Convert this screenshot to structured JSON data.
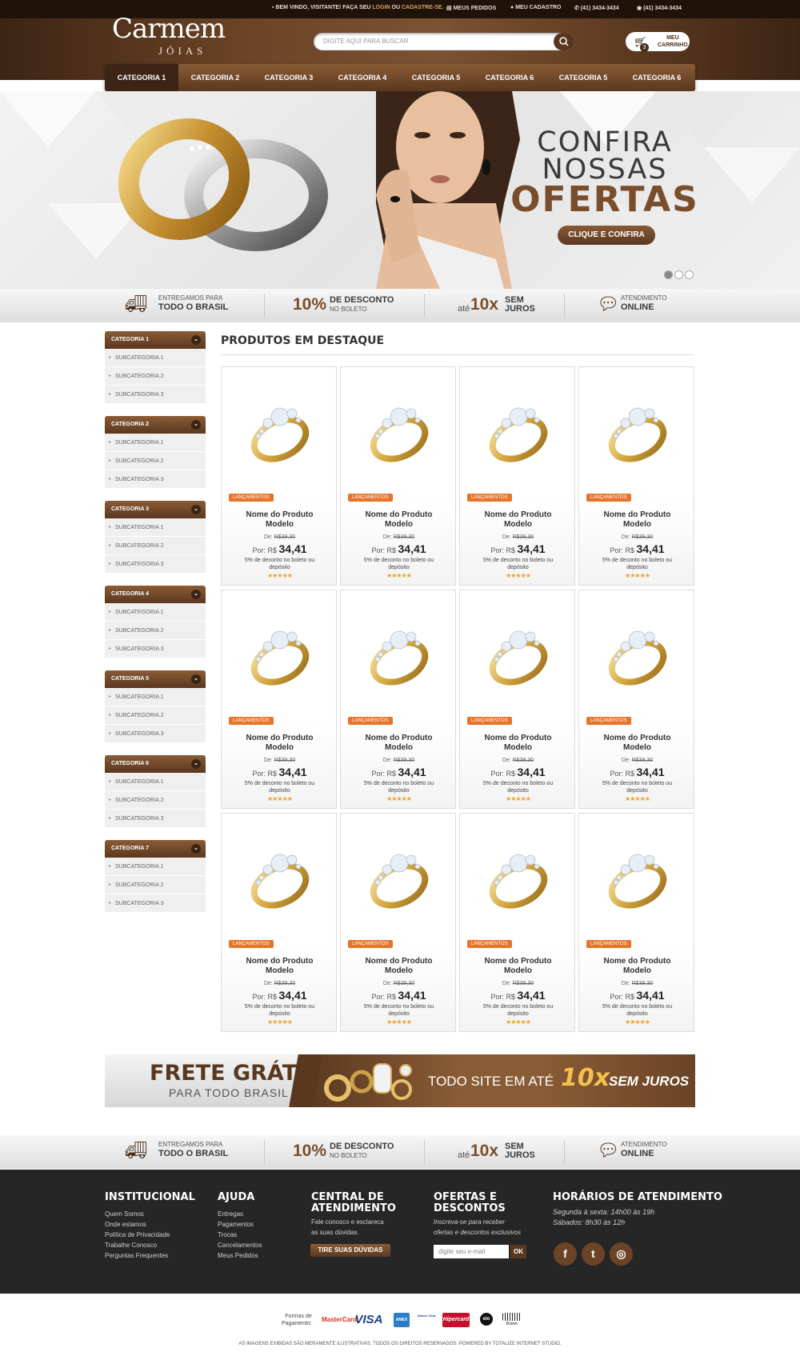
{
  "topbar": {
    "welcome_prefix": "BEM VINDO, VISITANTE! FAÇA SEU",
    "login": "LOGIN",
    "ou": "OU",
    "register": "CADASTRE-SE.",
    "orders": "MEUS PEDIDOS",
    "account": "MEU CADASTRO",
    "phone": "(41) 3434-3434",
    "whatsapp": "(41) 3434-3434"
  },
  "logo": {
    "name": "Carmem",
    "sub": "JÓIAS"
  },
  "search": {
    "placeholder": "DIGITE AQUI PARA BUSCAR"
  },
  "cart": {
    "label_line1": "MEU",
    "label_line2": "CARRINHO",
    "count": "3"
  },
  "nav": {
    "items": [
      "CATEGORIA 1",
      "CATEGORIA 2",
      "CATEGORIA 3",
      "CATEGORIA 4",
      "CATEGORIA 5",
      "CATEGORIA 6",
      "CATEGORIA 5",
      "CATEGORIA 6"
    ]
  },
  "banner": {
    "line1": "CONFIRA",
    "line2": "NOSSAS",
    "line3": "OFERTAS",
    "button": "CLIQUE E CONFIRA"
  },
  "features": {
    "delivery_small": "ENTREGAMOS PARA",
    "delivery_big": "TODO O BRASIL",
    "discount_pct": "10%",
    "discount_big": "DE DESCONTO",
    "discount_small": "NO BOLETO",
    "install_ate": "até",
    "install_x": "10x",
    "install_sem": "SEM",
    "install_juros": "JUROS",
    "support_small": "ATENDIMENTO",
    "support_big": "ONLINE"
  },
  "sidebar": {
    "categories": [
      {
        "title": "CATEGORIA 1",
        "subs": [
          "SUBCATEGORIA 1",
          "SUBCATEGORIA 2",
          "SUBCATEGORIA 3"
        ]
      },
      {
        "title": "CATEGORIA 2",
        "subs": [
          "SUBCATEGORIA 1",
          "SUBCATEGORIA 2",
          "SUBCATEGORIA 3"
        ]
      },
      {
        "title": "CATEGORIA 3",
        "subs": [
          "SUBCATEGORIA 1",
          "SUBCATEGORIA 2",
          "SUBCATEGORIA 3"
        ]
      },
      {
        "title": "CATEGORIA 4",
        "subs": [
          "SUBCATEGORIA 1",
          "SUBCATEGORIA 2",
          "SUBCATEGORIA 3"
        ]
      },
      {
        "title": "CATEGORIA 5",
        "subs": [
          "SUBCATEGORIA 1",
          "SUBCATEGORIA 2",
          "SUBCATEGORIA 3"
        ]
      },
      {
        "title": "CATEGORIA 6",
        "subs": [
          "SUBCATEGORIA 1",
          "SUBCATEGORIA 2",
          "SUBCATEGORIA 3"
        ]
      },
      {
        "title": "CATEGORIA 7",
        "subs": [
          "SUBCATEGORIA 1",
          "SUBCATEGORIA 2",
          "SUBCATEGORIA 3"
        ]
      }
    ]
  },
  "products": {
    "title": "PRODUTOS EM DESTAQUE",
    "items": [
      {
        "badge": "LANÇAMENTOS",
        "name1": "Nome do Produto",
        "name2": "Modelo",
        "de_label": "De:",
        "old_price": "R$39,30",
        "por_label": "Por:",
        "currency": "R$",
        "price": "34,41",
        "desc": "5% de deconto no boleto ou depósito",
        "stars": "★★★★★"
      },
      {
        "badge": "LANÇAMENTOS",
        "name1": "Nome do Produto",
        "name2": "Modelo",
        "de_label": "De:",
        "old_price": "R$39,30",
        "por_label": "Por:",
        "currency": "R$",
        "price": "34,41",
        "desc": "5% de deconto no boleto ou depósito",
        "stars": "★★★★★"
      },
      {
        "badge": "LANÇAMENTOS",
        "name1": "Nome do Produto",
        "name2": "Modelo",
        "de_label": "De:",
        "old_price": "R$39,30",
        "por_label": "Por:",
        "currency": "R$",
        "price": "34,41",
        "desc": "5% de deconto no boleto ou depósito",
        "stars": "★★★★★"
      },
      {
        "badge": "LANÇAMENTOS",
        "name1": "Nome do Produto",
        "name2": "Modelo",
        "de_label": "De:",
        "old_price": "R$39,30",
        "por_label": "Por:",
        "currency": "R$",
        "price": "34,41",
        "desc": "5% de deconto no boleto ou depósito",
        "stars": "★★★★★"
      },
      {
        "badge": "LANÇAMENTOS",
        "name1": "Nome do Produto",
        "name2": "Modelo",
        "de_label": "De:",
        "old_price": "R$39,30",
        "por_label": "Por:",
        "currency": "R$",
        "price": "34,41",
        "desc": "5% de deconto no boleto ou depósito",
        "stars": "★★★★★"
      },
      {
        "badge": "LANÇAMENTOS",
        "name1": "Nome do Produto",
        "name2": "Modelo",
        "de_label": "De:",
        "old_price": "R$39,30",
        "por_label": "Por:",
        "currency": "R$",
        "price": "34,41",
        "desc": "5% de deconto no boleto ou depósito",
        "stars": "★★★★★"
      },
      {
        "badge": "LANÇAMENTOS",
        "name1": "Nome do Produto",
        "name2": "Modelo",
        "de_label": "De:",
        "old_price": "R$39,30",
        "por_label": "Por:",
        "currency": "R$",
        "price": "34,41",
        "desc": "5% de deconto no boleto ou depósito",
        "stars": "★★★★★"
      },
      {
        "badge": "LANÇAMENTOS",
        "name1": "Nome do Produto",
        "name2": "Modelo",
        "de_label": "De:",
        "old_price": "R$39,30",
        "por_label": "Por:",
        "currency": "R$",
        "price": "34,41",
        "desc": "5% de deconto no boleto ou depósito",
        "stars": "★★★★★"
      },
      {
        "badge": "LANÇAMENTOS",
        "name1": "Nome do Produto",
        "name2": "Modelo",
        "de_label": "De:",
        "old_price": "R$39,30",
        "por_label": "Por:",
        "currency": "R$",
        "price": "34,41",
        "desc": "5% de deconto no boleto ou depósito",
        "stars": "★★★★★"
      },
      {
        "badge": "LANÇAMENTOS",
        "name1": "Nome do Produto",
        "name2": "Modelo",
        "de_label": "De:",
        "old_price": "R$39,30",
        "por_label": "Por:",
        "currency": "R$",
        "price": "34,41",
        "desc": "5% de deconto no boleto ou depósito",
        "stars": "★★★★★"
      },
      {
        "badge": "LANÇAMENTOS",
        "name1": "Nome do Produto",
        "name2": "Modelo",
        "de_label": "De:",
        "old_price": "R$39,30",
        "por_label": "Por:",
        "currency": "R$",
        "price": "34,41",
        "desc": "5% de deconto no boleto ou depósito",
        "stars": "★★★★★"
      },
      {
        "badge": "LANÇAMENTOS",
        "name1": "Nome do Produto",
        "name2": "Modelo",
        "de_label": "De:",
        "old_price": "R$39,30",
        "por_label": "Por:",
        "currency": "R$",
        "price": "34,41",
        "desc": "5% de deconto no boleto ou depósito",
        "stars": "★★★★★"
      }
    ]
  },
  "promo": {
    "frete": "FRETE GRÁTIS",
    "frete_sub": "PARA TODO BRASIL",
    "site": "TODO SITE EM ATÉ",
    "x": "10x",
    "juros": "SEM JUROS"
  },
  "footer": {
    "institucional": {
      "title": "INSTITUCIONAL",
      "links": [
        "Quem Somos",
        "Onde estamos",
        "Política de Privacidade",
        "Trabalhe Conosco",
        "Perguntas Frequentes"
      ]
    },
    "ajuda": {
      "title": "AJUDA",
      "links": [
        "Entregas",
        "Pagamentos",
        "Trocas",
        "Cancelamentos",
        "Meus Pedidos"
      ]
    },
    "central": {
      "title1": "CENTRAL DE",
      "title2": "ATENDIMENTO",
      "text1": "Fale conosco e esclareca",
      "text2": "as suas dúvidas.",
      "button": "TIRE SUAS DÚVIDAS"
    },
    "ofertas": {
      "title1": "OFERTAS E",
      "title2": "DESCONTOS",
      "text1": "Inscreva-se para receber",
      "text2": "ofertas e descontos exclusivos",
      "placeholder": "digite seu e-mail",
      "ok": "OK"
    },
    "horarios": {
      "title": "HORÁRIOS DE ATENDIMENTO",
      "line1": "Segunda à sexta: 14h00 às 19h",
      "line2": "Sábados: 8h30 às 12h"
    },
    "social": [
      "f",
      "t",
      "◎"
    ]
  },
  "payment": {
    "label1": "Formas de",
    "label2": "Pagamento:",
    "methods": [
      "MasterCard",
      "VISA",
      "AMEX",
      "Diners Club",
      "Hipercard",
      "elo",
      "Boleto"
    ]
  },
  "copyright": "AS IMAGENS EXIBIDAS SÃO MERAMENTE ILUSTRATIVAS. TODOS OS DIREITOS RESERVADOS. POWERED BY TOTALIZE INTERNET STUDIO.",
  "colors": {
    "brand_brown": "#6b4326",
    "dark_brown": "#3c2414",
    "accent_orange": "#e8742a",
    "gold": "#f3c14f",
    "footer_bg": "#262626"
  }
}
